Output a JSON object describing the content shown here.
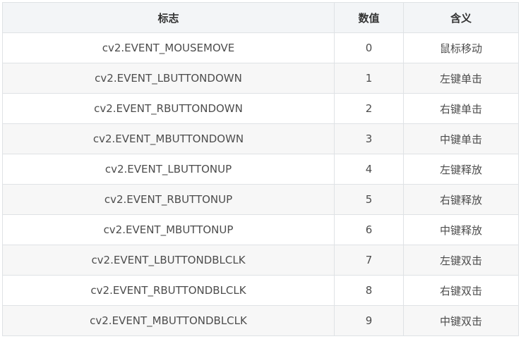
{
  "table": {
    "headers": [
      "标志",
      "数值",
      "含义"
    ],
    "rows": [
      {
        "flag": "cv2.EVENT_MOUSEMOVE",
        "value": "0",
        "meaning": "鼠标移动"
      },
      {
        "flag": "cv2.EVENT_LBUTTONDOWN",
        "value": "1",
        "meaning": "左键单击"
      },
      {
        "flag": "cv2.EVENT_RBUTTONDOWN",
        "value": "2",
        "meaning": "右键单击"
      },
      {
        "flag": "cv2.EVENT_MBUTTONDOWN",
        "value": "3",
        "meaning": "中键单击"
      },
      {
        "flag": "cv2.EVENT_LBUTTONUP",
        "value": "4",
        "meaning": "左键释放"
      },
      {
        "flag": "cv2.EVENT_RBUTTONUP",
        "value": "5",
        "meaning": "右键释放"
      },
      {
        "flag": "cv2.EVENT_MBUTTONUP",
        "value": "6",
        "meaning": "中键释放"
      },
      {
        "flag": "cv2.EVENT_LBUTTONDBLCLK",
        "value": "7",
        "meaning": "左键双击"
      },
      {
        "flag": "cv2.EVENT_RBUTTONDBLCLK",
        "value": "8",
        "meaning": "右键双击"
      },
      {
        "flag": "cv2.EVENT_MBUTTONDBLCLK",
        "value": "9",
        "meaning": "中键双击"
      }
    ]
  }
}
